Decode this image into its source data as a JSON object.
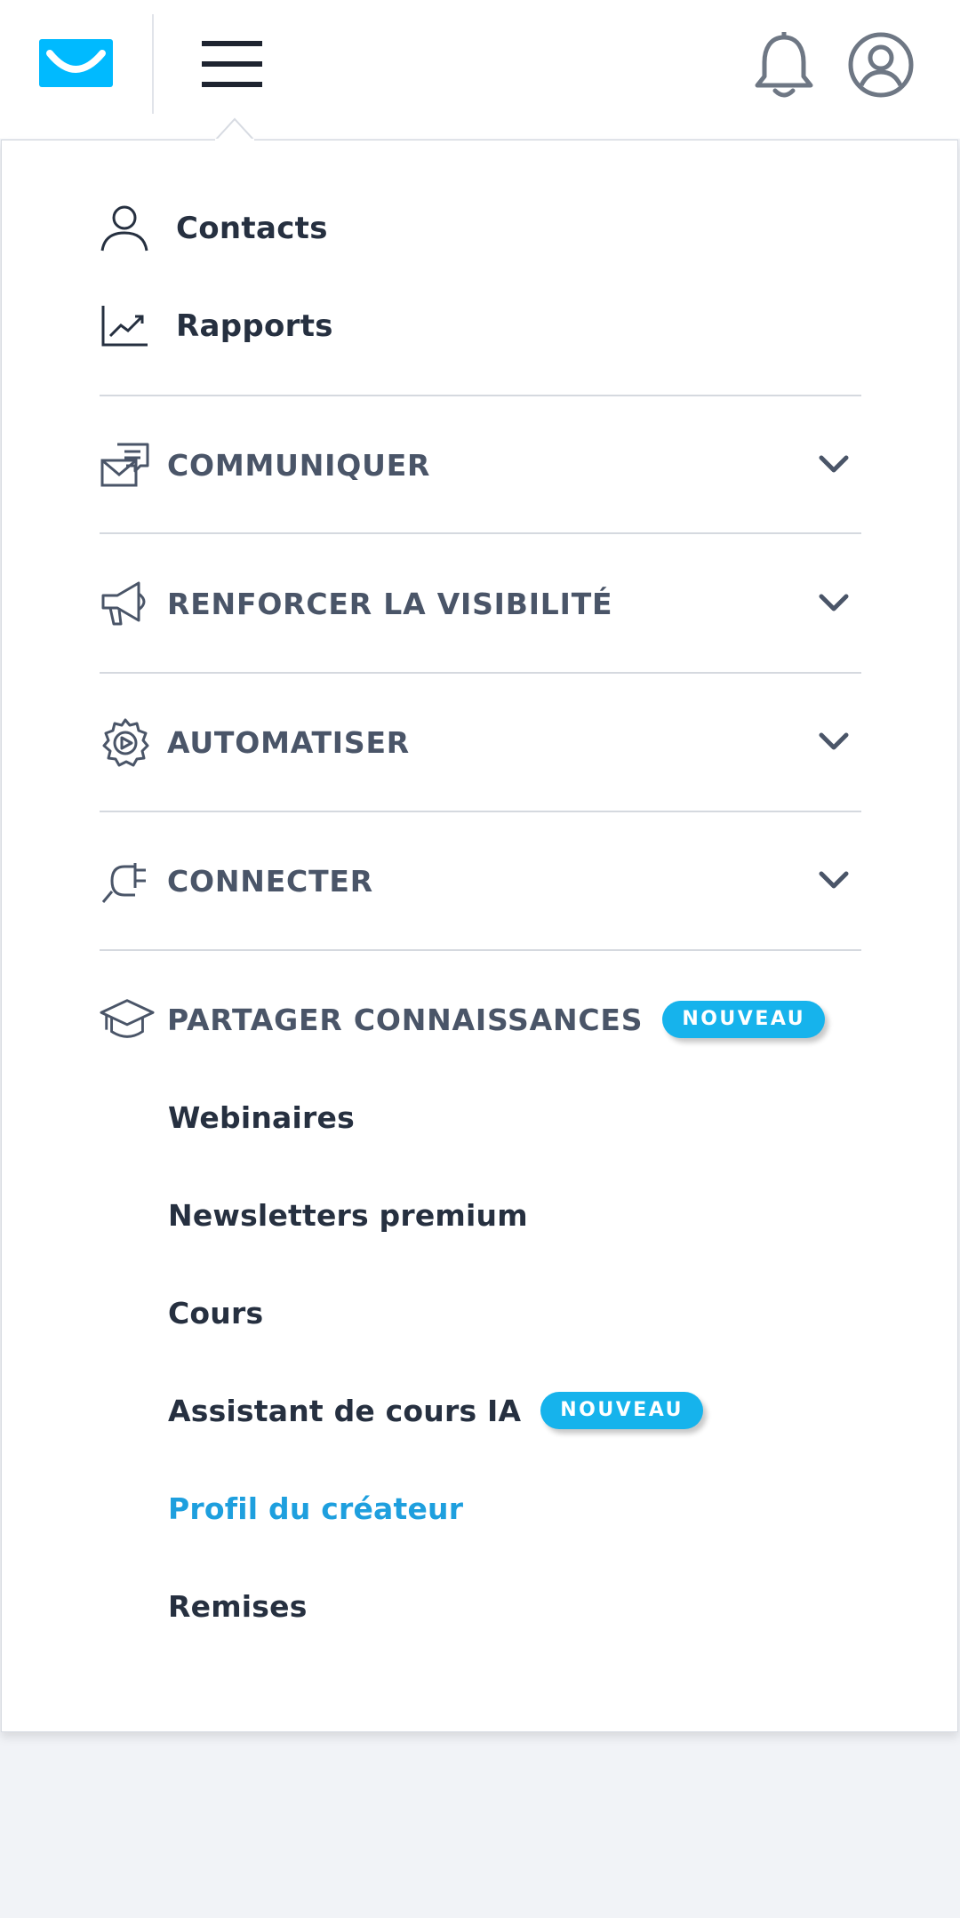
{
  "header": {
    "logo_icon": "getresponse-envelope-logo",
    "menu_icon": "hamburger-icon",
    "notifications_icon": "bell-icon",
    "account_icon": "user-circle-icon"
  },
  "menu": {
    "top_links": [
      {
        "label": "Contacts",
        "icon": "person-icon"
      },
      {
        "label": "Rapports",
        "icon": "chart-line-icon"
      }
    ],
    "sections": [
      {
        "label": "COMMUNIQUER",
        "icon": "envelope-chat-icon",
        "expanded": false
      },
      {
        "label": "RENFORCER LA VISIBILITÉ",
        "icon": "megaphone-icon",
        "expanded": false
      },
      {
        "label": "AUTOMATISER",
        "icon": "gear-play-icon",
        "expanded": false
      },
      {
        "label": "CONNECTER",
        "icon": "plug-icon",
        "expanded": false
      }
    ],
    "knowledge": {
      "label": "PARTAGER CONNAISSANCES",
      "icon": "graduation-cap-icon",
      "badge": "NOUVEAU",
      "items": [
        {
          "label": "Webinaires"
        },
        {
          "label": "Newsletters premium"
        },
        {
          "label": "Cours"
        },
        {
          "label": "Assistant de cours IA",
          "badge": "NOUVEAU"
        },
        {
          "label": "Profil du créateur",
          "active": true
        },
        {
          "label": "Remises"
        }
      ]
    }
  },
  "colors": {
    "brand": "#00baff",
    "badge": "#16b3ec",
    "active_link": "#1e9fde",
    "text_dark": "#263040",
    "text_section": "#4a5568",
    "background": "#f1f3f7"
  }
}
